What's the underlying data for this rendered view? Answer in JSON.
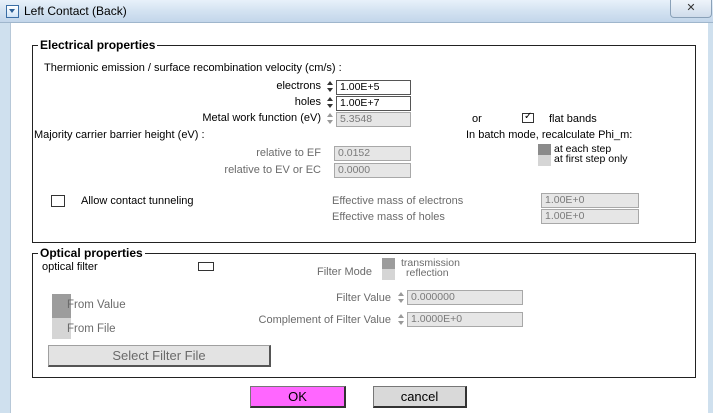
{
  "window": {
    "title": "Left Contact (Back)",
    "close_symbol": "✕"
  },
  "electrical": {
    "title": "Electrical properties",
    "thermionic_label": "Thermionic emission / surface recombination velocity (cm/s) :",
    "electrons_label": "electrons",
    "electrons_value": "1.00E+5",
    "holes_label": "holes",
    "holes_value": "1.00E+7",
    "work_function_label": "Metal work function (eV)",
    "work_function_value": "5.3548",
    "or_label": "or",
    "flat_bands_label": "flat bands",
    "flat_bands_checked": true,
    "majority_label": "Majority carrier barrier height (eV) :",
    "relative_ef_label": "relative to EF",
    "relative_ef_value": "0.0152",
    "relative_ev_label": "relative to EV or EC",
    "relative_ev_value": "0.0000",
    "batch_label": "In batch mode, recalculate Phi_m:",
    "at_each_step": "at each step",
    "at_first_step": "at first step only",
    "allow_tunneling_label": "Allow contact tunneling",
    "allow_tunneling_checked": false,
    "eff_mass_electrons_label": "Effective mass of electrons",
    "eff_mass_electrons_value": "1.00E+0",
    "eff_mass_holes_label": "Effective mass of holes",
    "eff_mass_holes_value": "1.00E+0"
  },
  "optical": {
    "title": "Optical properties",
    "filter_label": "optical filter",
    "filter_checked": false,
    "filter_mode_label": "Filter Mode",
    "mode_transmission": "transmission",
    "mode_reflection": "reflection",
    "from_value": "From Value",
    "from_file": "From File",
    "filter_value_label": "Filter Value",
    "filter_value": "0.000000",
    "complement_label": "Complement of Filter Value",
    "complement_value": "1.0000E+0",
    "select_file_button": "Select Filter File"
  },
  "buttons": {
    "ok": "OK",
    "cancel": "cancel"
  },
  "colors": {
    "ok_button": "#ff66ff",
    "cancel_button": "#d9d9d9",
    "titlebar": "#d5e4f2"
  }
}
